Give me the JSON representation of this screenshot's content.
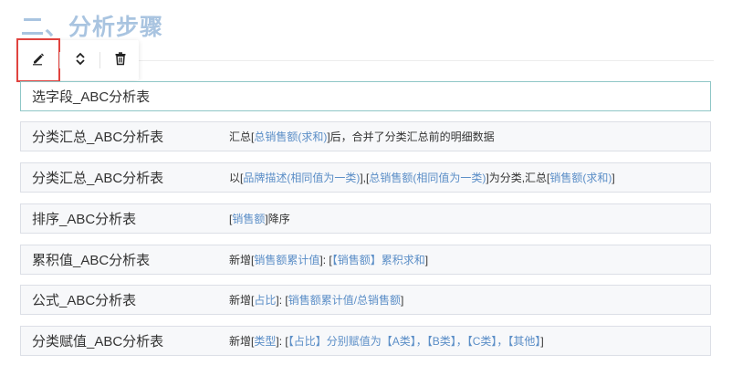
{
  "page": {
    "heading": "二、分析步骤"
  },
  "toolbar": {
    "buttons": [
      {
        "name": "edit-button",
        "icon": "pencil-icon"
      },
      {
        "name": "move-button",
        "icon": "chevron-updown-icon"
      },
      {
        "name": "delete-button",
        "icon": "trash-icon"
      }
    ]
  },
  "steps": [
    {
      "title": "选字段_ABC分析表",
      "desc": []
    },
    {
      "title": "分类汇总_ABC分析表",
      "desc": [
        {
          "t": "汇总[",
          "hl": false
        },
        {
          "t": "总销售额(求和)",
          "hl": true
        },
        {
          "t": "]后，合并了分类汇总前的明细数据",
          "hl": false
        }
      ]
    },
    {
      "title": "分类汇总_ABC分析表",
      "desc": [
        {
          "t": "以[",
          "hl": false
        },
        {
          "t": "品牌描述(相同值为一类)",
          "hl": true
        },
        {
          "t": "],[",
          "hl": false
        },
        {
          "t": "总销售额(相同值为一类)",
          "hl": true
        },
        {
          "t": "]为分类,汇总[",
          "hl": false
        },
        {
          "t": "销售额(求和)",
          "hl": true
        },
        {
          "t": "]",
          "hl": false
        }
      ]
    },
    {
      "title": "排序_ABC分析表",
      "desc": [
        {
          "t": "[",
          "hl": false
        },
        {
          "t": "销售额",
          "hl": true
        },
        {
          "t": "]降序",
          "hl": false
        }
      ]
    },
    {
      "title": "累积值_ABC分析表",
      "desc": [
        {
          "t": "新增[",
          "hl": false
        },
        {
          "t": "销售额累计值",
          "hl": true
        },
        {
          "t": "]: [",
          "hl": false
        },
        {
          "t": "【销售额】累积求和",
          "hl": true
        },
        {
          "t": "]",
          "hl": false
        }
      ]
    },
    {
      "title": "公式_ABC分析表",
      "desc": [
        {
          "t": "新增[",
          "hl": false
        },
        {
          "t": "占比",
          "hl": true
        },
        {
          "t": "]: [",
          "hl": false
        },
        {
          "t": "销售额累计值/总销售额",
          "hl": true
        },
        {
          "t": "]",
          "hl": false
        }
      ]
    },
    {
      "title": "分类赋值_ABC分析表",
      "desc": [
        {
          "t": "新增[",
          "hl": false
        },
        {
          "t": "类型",
          "hl": true
        },
        {
          "t": "]: [",
          "hl": false
        },
        {
          "t": "【占比】分别赋值为【A类】，【B类】，【C类】，【其他】",
          "hl": true
        },
        {
          "t": "]",
          "hl": false
        }
      ]
    }
  ],
  "colors": {
    "heading": "#a9c4e0",
    "highlight": "#5b8ec7",
    "selected_outline": "#e0433f",
    "active_border": "#8fc7c7"
  }
}
